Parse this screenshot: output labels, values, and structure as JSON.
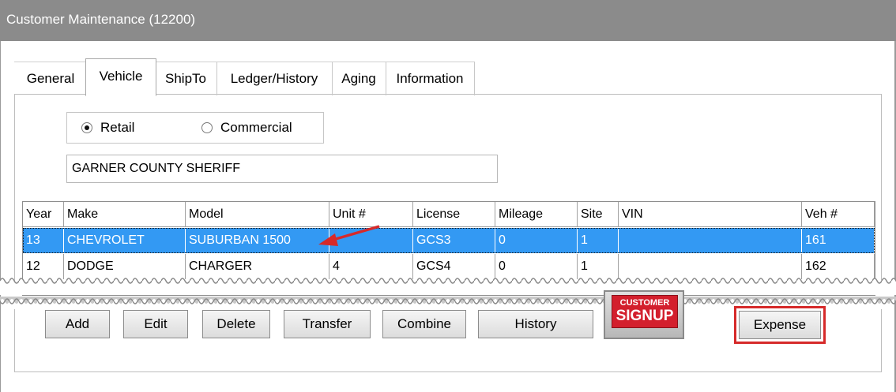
{
  "window": {
    "title": "Customer Maintenance (12200)"
  },
  "tabs": [
    "General",
    "Vehicle",
    "ShipTo",
    "Ledger/History",
    "Aging",
    "Information"
  ],
  "selected_tab": "Vehicle",
  "customer_type": {
    "options": [
      "Retail",
      "Commercial"
    ],
    "selected": "Retail"
  },
  "customer_name": "GARNER COUNTY SHERIFF",
  "vehicles": {
    "columns": [
      "Year",
      "Make",
      "Model",
      "Unit #",
      "License",
      "Mileage",
      "Site",
      "VIN",
      "Veh #"
    ],
    "rows": [
      {
        "year": "13",
        "make": "CHEVROLET",
        "model": "SUBURBAN 1500",
        "unit": "",
        "license": "GCS3",
        "mileage": "0",
        "site": "1",
        "vin": "",
        "veh": "161"
      },
      {
        "year": "12",
        "make": "DODGE",
        "model": "CHARGER",
        "unit": "4",
        "license": "GCS4",
        "mileage": "0",
        "site": "1",
        "vin": "",
        "veh": "162"
      }
    ],
    "selected_row": 0
  },
  "buttons": {
    "add": "Add",
    "edit": "Edit",
    "delete": "Delete",
    "transfer": "Transfer",
    "combine": "Combine",
    "history": "History",
    "expense": "Expense"
  },
  "signup_badge": {
    "line1": "CUSTOMER",
    "line2": "SIGNUP"
  },
  "colors": {
    "titlebar": "#8b8b8b",
    "selection": "#3399f3",
    "highlight_box": "#d62a2a",
    "badge": "#d31f2d"
  }
}
